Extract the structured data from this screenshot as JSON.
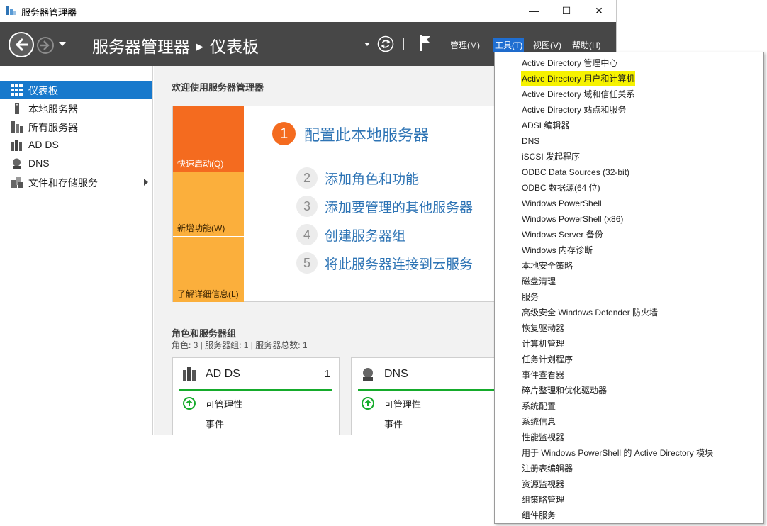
{
  "window": {
    "title": "服务器管理器",
    "minimize_label": "—",
    "maximize_label": "☐",
    "close_label": "✕"
  },
  "header": {
    "breadcrumb_root": "服务器管理器",
    "breadcrumb_sep": "▶",
    "breadcrumb_current": "仪表板",
    "menus": [
      "管理(M)",
      "工具(T)",
      "视图(V)",
      "帮助(H)"
    ],
    "active_menu": "工具(T)"
  },
  "sidebar": {
    "items": [
      {
        "label": "仪表板",
        "icon": "dashboard-grid-icon",
        "selected": true
      },
      {
        "label": "本地服务器",
        "icon": "server-icon"
      },
      {
        "label": "所有服务器",
        "icon": "servers-icon"
      },
      {
        "label": "AD DS",
        "icon": "ad-ds-icon"
      },
      {
        "label": "DNS",
        "icon": "dns-icon"
      },
      {
        "label": "文件和存储服务",
        "icon": "file-storage-icon",
        "has_submenu": true
      }
    ]
  },
  "main": {
    "welcome_title": "欢迎使用服务器管理器",
    "tiles": [
      "快速启动(Q)",
      "新增功能(W)",
      "了解详细信息(L)"
    ],
    "steps": [
      {
        "num": "1",
        "label": "配置此本地服务器"
      },
      {
        "num": "2",
        "label": "添加角色和功能"
      },
      {
        "num": "3",
        "label": "添加要管理的其他服务器"
      },
      {
        "num": "4",
        "label": "创建服务器组"
      },
      {
        "num": "5",
        "label": "将此服务器连接到云服务"
      }
    ],
    "roles_title": "角色和服务器组",
    "roles_summary": "角色: 3 | 服务器组: 1 | 服务器总数: 1",
    "role_cards": [
      {
        "name": "AD DS",
        "count": "1",
        "manageability": "可管理性",
        "events": "事件"
      },
      {
        "name": "DNS",
        "count": "",
        "manageability": "可管理性",
        "events": "事件"
      }
    ]
  },
  "tools_menu": {
    "highlight_color": "#f6f200",
    "items": [
      "Active Directory 管理中心",
      "Active Directory 用户和计算机",
      "Active Directory 域和信任关系",
      "Active Directory 站点和服务",
      "ADSI 编辑器",
      "DNS",
      "iSCSI 发起程序",
      "ODBC Data Sources (32-bit)",
      "ODBC 数据源(64 位)",
      "Windows PowerShell",
      "Windows PowerShell (x86)",
      "Windows Server 备份",
      "Windows 内存诊断",
      "本地安全策略",
      "磁盘清理",
      "服务",
      "高级安全 Windows Defender 防火墙",
      "恢复驱动器",
      "计算机管理",
      "任务计划程序",
      "事件查看器",
      "碎片整理和优化驱动器",
      "系统配置",
      "系统信息",
      "性能监视器",
      "用于 Windows PowerShell 的 Active Directory 模块",
      "注册表编辑器",
      "资源监视器",
      "组策略管理",
      "组件服务"
    ],
    "highlighted_item": "Active Directory 用户和计算机"
  }
}
